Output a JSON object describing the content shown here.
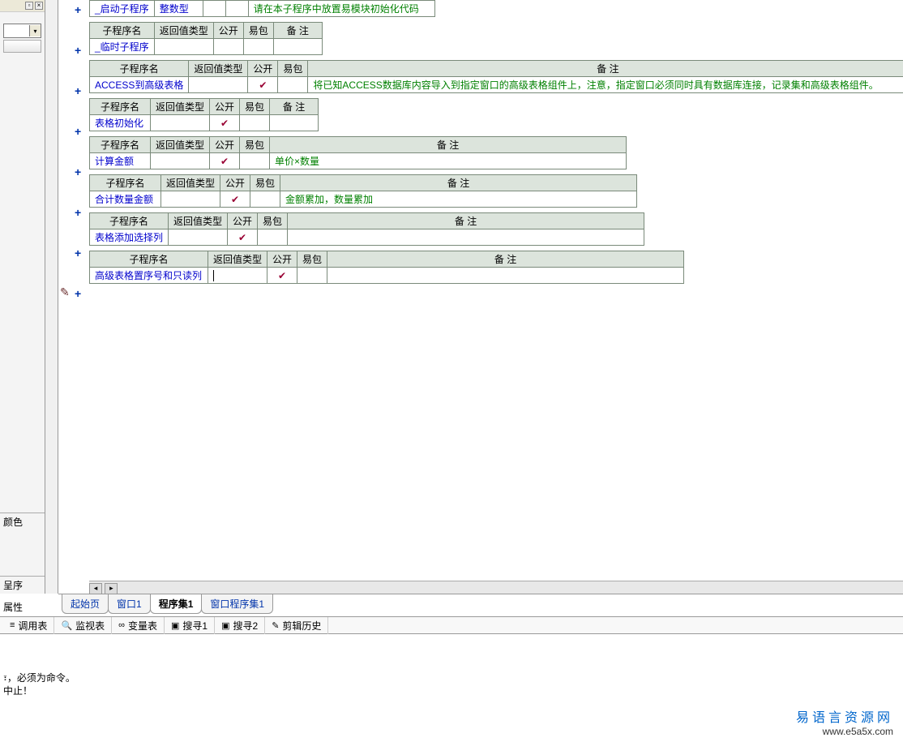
{
  "left_panel": {
    "color_label": "颜色",
    "prog_label": "呈序",
    "attr_label": "属性"
  },
  "headers": {
    "name": "子程序名",
    "return_type": "返回值类型",
    "pub": "公开",
    "pkg": "易包",
    "remark": "备 注"
  },
  "checkmark": "✔",
  "subs": [
    {
      "name": "_启动子程序",
      "return_type": "整数型",
      "pub": "",
      "pkg": "",
      "remark": "请在本子程序中放置易模块初始化代码",
      "name_w": 75,
      "type_w": 60,
      "remark_w": 230,
      "show_header": false
    },
    {
      "name": "_临时子程序",
      "return_type": "",
      "pub": "",
      "pkg": "",
      "remark": "",
      "name_w": 75,
      "type_w": 60,
      "remark_w": 60,
      "show_header": true
    },
    {
      "name": "ACCESS到高级表格",
      "return_type": "",
      "pub": "✔",
      "pkg": "",
      "remark": "将已知ACCESS数据库内容导入到指定窗口的高级表格组件上，注意，指定窗口必须同时具有数据库连接，记录集和高级表格组件。",
      "name_w": 110,
      "type_w": 60,
      "remark_w": 740,
      "show_header": true
    },
    {
      "name": "表格初始化",
      "return_type": "",
      "pub": "✔",
      "pkg": "",
      "remark": "",
      "name_w": 75,
      "type_w": 60,
      "remark_w": 60,
      "show_header": true
    },
    {
      "name": "计算金额",
      "return_type": "",
      "pub": "✔",
      "pkg": "",
      "remark": "单价×数量",
      "name_w": 75,
      "type_w": 60,
      "remark_w": 440,
      "show_header": true
    },
    {
      "name": "合计数量金额",
      "return_type": "",
      "pub": "✔",
      "pkg": "",
      "remark": "金额累加，数量累加",
      "name_w": 88,
      "type_w": 60,
      "remark_w": 440,
      "show_header": true
    },
    {
      "name": "表格添加选择列",
      "return_type": "",
      "pub": "✔",
      "pkg": "",
      "remark": "",
      "name_w": 96,
      "type_w": 60,
      "remark_w": 440,
      "show_header": true
    },
    {
      "name": "高级表格置序号和只读列",
      "return_type": "",
      "pub": "✔",
      "pkg": "",
      "remark": "",
      "name_w": 146,
      "type_w": 60,
      "remark_w": 440,
      "show_header": true,
      "editing": true
    }
  ],
  "doc_tabs": {
    "items": [
      "起始页",
      "窗口1",
      "程序集1",
      "窗口程序集1"
    ],
    "active": 2
  },
  "bottom_tabs": [
    {
      "icon": "≡",
      "label": "调用表"
    },
    {
      "icon": "🔍",
      "label": "监视表"
    },
    {
      "icon": "∞",
      "label": "变量表"
    },
    {
      "icon": "▣",
      "label": "搜寻1"
    },
    {
      "icon": "▣",
      "label": "搜寻2"
    },
    {
      "icon": "✎",
      "label": "剪辑历史"
    }
  ],
  "output": {
    "line1": "፣，必须为命令。",
    "line2": "中止！"
  },
  "watermark": {
    "title": "易语言资源网",
    "url": "www.e5a5x.com"
  }
}
